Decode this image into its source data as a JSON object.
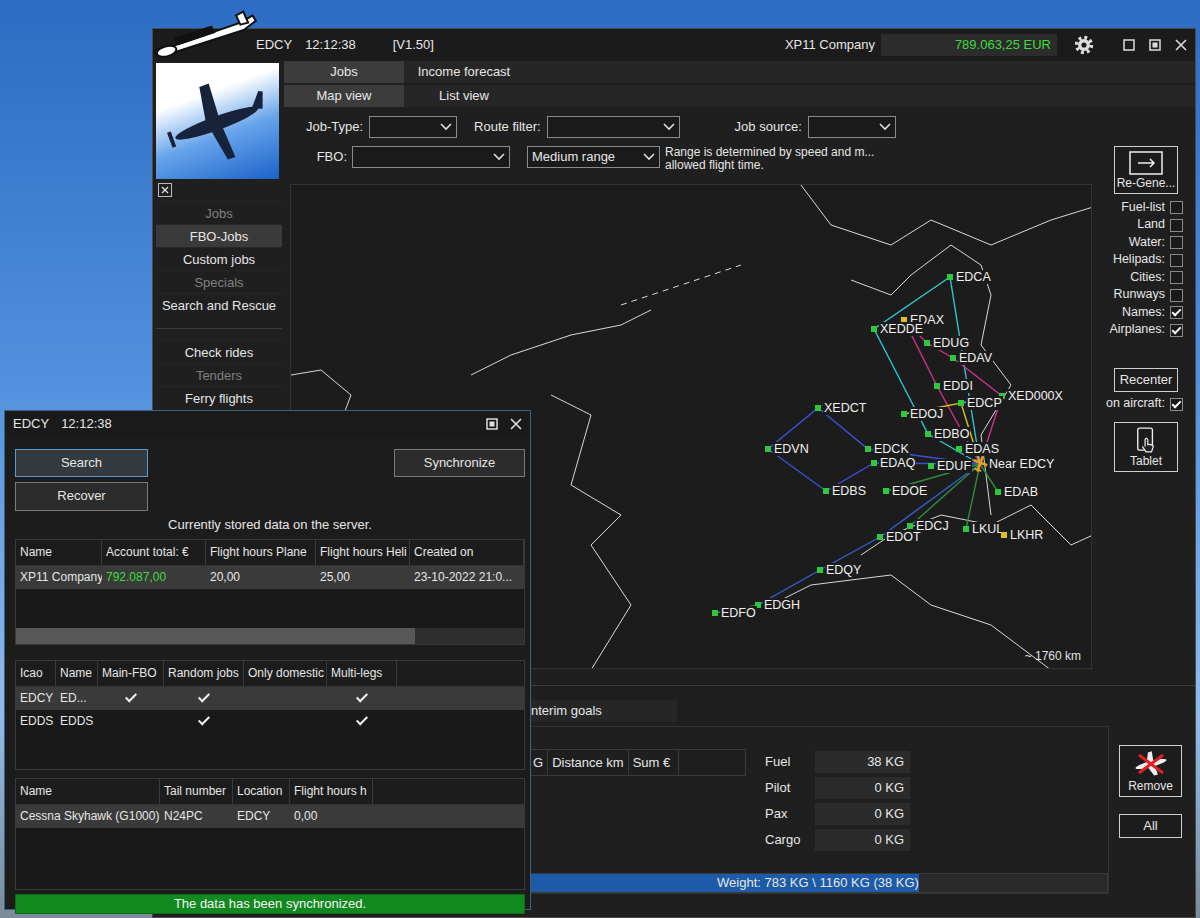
{
  "main_window": {
    "location": "EDCY",
    "time": "12:12:38",
    "version": "[V1.50]",
    "company": "XP11 Company",
    "balance": "789.063,25 EUR"
  },
  "sidebar": {
    "groups": [
      {
        "items": [
          {
            "label": "Jobs",
            "kind": "header",
            "selected": false
          },
          {
            "label": "FBO-Jobs",
            "kind": "item",
            "selected": true
          },
          {
            "label": "Custom jobs",
            "kind": "item",
            "selected": false
          },
          {
            "label": "Specials",
            "kind": "header",
            "selected": false
          },
          {
            "label": "Search and Rescue",
            "kind": "item",
            "selected": false
          }
        ]
      },
      {
        "items": [
          {
            "label": "Check rides",
            "kind": "item",
            "selected": false
          },
          {
            "label": "Tenders",
            "kind": "header",
            "selected": false
          },
          {
            "label": "Ferry flights",
            "kind": "item",
            "selected": false
          }
        ]
      }
    ]
  },
  "tabs": [
    {
      "label": "Jobs",
      "selected": true
    },
    {
      "label": "Income forecast",
      "selected": false
    }
  ],
  "view_tabs": [
    {
      "label": "Map view",
      "selected": true
    },
    {
      "label": "List view",
      "selected": false
    }
  ],
  "filters": [
    {
      "label": "Job-Type:",
      "value": ""
    },
    {
      "label": "Route filter:",
      "value": ""
    },
    {
      "label": "Job source:",
      "value": ""
    }
  ],
  "fbo_filter": {
    "label": "FBO:",
    "value": ""
  },
  "range": {
    "value": "Medium range",
    "note": [
      "Range is determined by speed and m...",
      "allowed flight time."
    ]
  },
  "map": {
    "scale": "~ 1760 km",
    "aircraft": {
      "label": "Near EDCY"
    },
    "airports": [
      {
        "label": "EDCA",
        "color": "#2ec83c"
      },
      {
        "label": "EDAX",
        "color": "#e0c020"
      },
      {
        "label": "XEDDE",
        "color": "#2ec83c"
      },
      {
        "label": "EDUG",
        "color": "#2ec83c"
      },
      {
        "label": "EDAV",
        "color": "#2ec83c"
      },
      {
        "label": "EDDI",
        "color": "#2ec83c"
      },
      {
        "label": "XED000X",
        "color": "#2ec83c"
      },
      {
        "label": "EDCP",
        "color": "#2ec83c"
      },
      {
        "label": "XEDCT",
        "color": "#2ec83c"
      },
      {
        "label": "EDOJ",
        "color": "#2ec83c"
      },
      {
        "label": "EDBO",
        "color": "#2ec83c"
      },
      {
        "label": "EDVN",
        "color": "#2ec83c"
      },
      {
        "label": "EDCK",
        "color": "#2ec83c"
      },
      {
        "label": "EDAS",
        "color": "#2ec83c"
      },
      {
        "label": "EDAQ",
        "color": "#2ec83c"
      },
      {
        "label": "EDUF",
        "color": "#2ec83c"
      },
      {
        "label": "EDBS",
        "color": "#2ec83c"
      },
      {
        "label": "EDOE",
        "color": "#2ec83c"
      },
      {
        "label": "EDAB",
        "color": "#2ec83c"
      },
      {
        "label": "EDCJ",
        "color": "#2ec83c"
      },
      {
        "label": "LKUL",
        "color": "#2ec83c"
      },
      {
        "label": "LKHR",
        "color": "#e0c020"
      },
      {
        "label": "EDOT",
        "color": "#2ec83c"
      },
      {
        "label": "EDQY",
        "color": "#2ec83c"
      },
      {
        "label": "EDGH",
        "color": "#2ec83c"
      },
      {
        "label": "EDFO",
        "color": "#2ec83c"
      }
    ],
    "routes": [
      {
        "color": "#2ec4d0",
        "stops": [
          "Near EDCY",
          "EDCA",
          "XEDDE",
          "EDBO",
          "Near EDCY"
        ]
      },
      {
        "color": "#2ec4d0",
        "stops": [
          "EDCP",
          "XED000X"
        ]
      },
      {
        "color": "#d0308a",
        "stops": [
          "Near EDCY",
          "EDDI",
          "EDAX",
          "EDUG",
          "EDAV",
          "XED000X",
          "Near EDCY"
        ]
      },
      {
        "color": "#3b4fd8",
        "stops": [
          "Near EDCY",
          "EDCK",
          "XEDCT",
          "EDVN",
          "EDBS",
          "EDAQ",
          "Near EDCY"
        ]
      },
      {
        "color": "#3560d0",
        "stops": [
          "Near EDCY",
          "EDOT",
          "EDQY",
          "EDGH"
        ]
      },
      {
        "color": "#d8c020",
        "stops": [
          "Near EDCY",
          "EDCP",
          "EDOJ"
        ]
      },
      {
        "color": "#2e8e3a",
        "stops": [
          "Near EDCY",
          "EDCJ"
        ]
      },
      {
        "color": "#2e8e3a",
        "stops": [
          "Near EDCY",
          "LKUL"
        ]
      },
      {
        "color": "#2e8e3a",
        "stops": [
          "Near EDCY",
          "EDAB"
        ]
      },
      {
        "color": "#2e8e3a",
        "stops": [
          "Near EDCY",
          "EDOE"
        ]
      },
      {
        "color": "#2e8e3a",
        "stops": [
          "EDFO",
          "EDGH"
        ]
      }
    ]
  },
  "map_options": {
    "regenerate": "Re-Gene...",
    "toggles": [
      {
        "label": "Fuel-list",
        "checked": false
      },
      {
        "label": "Land",
        "checked": false
      },
      {
        "label": "Water:",
        "checked": false
      },
      {
        "label": "Helipads:",
        "checked": false
      },
      {
        "label": "Cities:",
        "checked": false
      },
      {
        "label": "Runways",
        "checked": false
      },
      {
        "label": "Names:",
        "checked": true
      },
      {
        "label": "Airplanes:",
        "checked": true
      }
    ],
    "recenter": "Recenter",
    "on_aircraft": {
      "label": "on aircraft:",
      "checked": true
    },
    "tablet": "Tablet"
  },
  "loadout": {
    "tab": "nterim goals",
    "columns": [
      "G",
      "Distance km",
      "Sum €"
    ],
    "weights": [
      {
        "label": "Fuel",
        "value": "38 KG"
      },
      {
        "label": "Pilot",
        "value": "0 KG"
      },
      {
        "label": "Pax",
        "value": "0 KG"
      },
      {
        "label": "Cargo",
        "value": "0 KG"
      }
    ],
    "weight_bar": {
      "text": "Weight: 783 KG \\ 1160 KG (38 KG)",
      "level": 0.675
    },
    "remove": "Remove",
    "all": "All"
  },
  "sync_window": {
    "location": "EDCY",
    "time": "12:12:38",
    "search": {
      "label": "Search",
      "selected": true
    },
    "recover": "Recover",
    "synchronize": "Synchronize",
    "caption": "Currently stored data on the server.",
    "accounts": {
      "columns": [
        "Name",
        "Account total: €",
        "Flight hours Plane",
        "Flight hours Heli",
        "Created on"
      ],
      "rows": [
        {
          "cells": [
            "XP11 Company",
            "792.087,00",
            "20,00",
            "25,00",
            "23-10-2022 21:0..."
          ],
          "selected": true
        }
      ]
    },
    "fbos": {
      "columns": [
        "Icao",
        "Name",
        "Main-FBO",
        "Random jobs",
        "Only domestic",
        "Multi-legs"
      ],
      "rows": [
        {
          "icao": "EDCY",
          "name": "ED...",
          "main_fbo": true,
          "random_jobs": true,
          "only_domestic": false,
          "multi_legs": true,
          "selected": true
        },
        {
          "icao": "EDDS",
          "name": "EDDS",
          "main_fbo": false,
          "random_jobs": true,
          "only_domestic": false,
          "multi_legs": true,
          "selected": false
        }
      ]
    },
    "aircraft": {
      "columns": [
        "Name",
        "Tail number",
        "Location",
        "Flight hours h"
      ],
      "rows": [
        {
          "cells": [
            "Cessna Skyhawk (G1000)",
            "N24PC",
            "EDCY",
            "0,00"
          ],
          "selected": true
        }
      ]
    },
    "status": "The data has been synchronized."
  }
}
